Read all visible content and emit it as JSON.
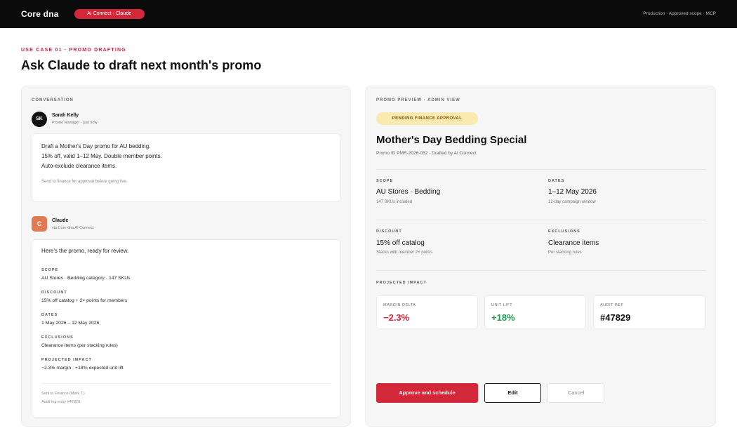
{
  "topbar": {
    "brand": "Core dna",
    "pill": "AI Connect · Claude",
    "status": "Production · Approved scope · MCP"
  },
  "header": {
    "eyebrow": "USE CASE 01 · PROMO DRAFTING",
    "title": "Ask Claude to draft next month's promo"
  },
  "conversation": {
    "label": "CONVERSATION",
    "user": {
      "initials": "SK",
      "name": "Sarah Kelly",
      "meta": "Promo Manager · just now",
      "lines": [
        "Draft a Mother's Day promo for AU bedding.",
        "15% off, valid 1–12 May. Double member points.",
        "Auto-exclude clearance items."
      ],
      "note": "Send to finance for approval before going live."
    },
    "ai": {
      "initial": "C",
      "name": "Claude",
      "meta": "via Core dna AI Connect",
      "intro": "Here's the promo, ready for review.",
      "fields": [
        {
          "key": "SCOPE",
          "value": "AU Stores · Bedding category · 147 SKUs"
        },
        {
          "key": "DISCOUNT",
          "value": "15% off catalog + 2× points for members"
        },
        {
          "key": "DATES",
          "value": "1 May 2026 – 12 May 2026"
        },
        {
          "key": "EXCLUSIONS",
          "value": "Clearance items (per stacking rules)"
        },
        {
          "key": "PROJECTED IMPACT",
          "value": "−2.3% margin · +18% expected unit lift"
        }
      ],
      "footer": [
        "Sent to Finance (Mark T.)",
        "Audit log entry #47829"
      ]
    }
  },
  "preview": {
    "label": "PROMO PREVIEW · ADMIN VIEW",
    "badge": "PENDING FINANCE APPROVAL",
    "title": "Mother's Day Bedding Special",
    "promo_id": "Promo ID PMR-2026-052 · Drafted by AI Connect",
    "scope": {
      "key": "SCOPE",
      "value": "AU Stores · Bedding",
      "sub": "147 SKUs included"
    },
    "dates": {
      "key": "DATES",
      "value": "1–12 May 2026",
      "sub": "12-day campaign window"
    },
    "discount": {
      "key": "DISCOUNT",
      "value": "15% off catalog",
      "sub": "Stacks with member 2× points"
    },
    "exclusions": {
      "key": "EXCLUSIONS",
      "value": "Clearance items",
      "sub": "Per stacking rules"
    },
    "impact_label": "PROJECTED IMPACT",
    "impact": [
      {
        "label": "MARGIN DELTA",
        "value": "−2.3%",
        "color": "#d2283a"
      },
      {
        "label": "UNIT LIFT",
        "value": "+18%",
        "color": "#1f9d55"
      },
      {
        "label": "AUDIT REF",
        "value": "#47829",
        "color": "#111111"
      }
    ],
    "buttons": {
      "approve": "Approve and schedule",
      "edit": "Edit",
      "cancel": "Cancel"
    }
  }
}
